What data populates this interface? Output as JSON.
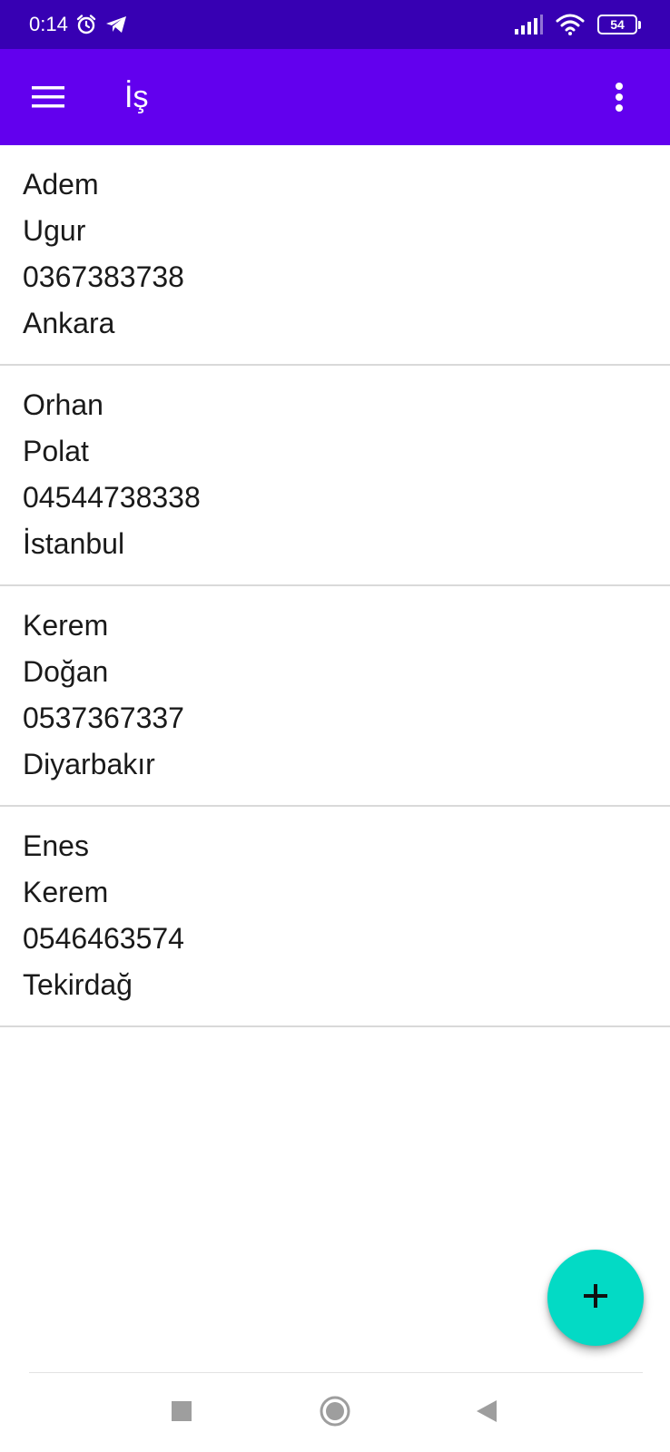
{
  "status_bar": {
    "time": "0:14",
    "battery_level": "54",
    "icons": [
      "alarm-icon",
      "telegram-icon",
      "signal-icon",
      "wifi-icon",
      "battery-icon"
    ]
  },
  "app_bar": {
    "title": "İş",
    "menu_icon": "hamburger-menu-icon",
    "overflow_icon": "more-vert-icon"
  },
  "contacts": [
    {
      "first_name": "Adem",
      "last_name": "Ugur",
      "phone": "0367383738",
      "city": "Ankara"
    },
    {
      "first_name": "Orhan",
      "last_name": "Polat",
      "phone": "04544738338",
      "city": "İstanbul"
    },
    {
      "first_name": "Kerem",
      "last_name": "Doğan",
      "phone": "0537367337",
      "city": "Diyarbakır"
    },
    {
      "first_name": "Enes",
      "last_name": "Kerem",
      "phone": "0546463574",
      "city": "Tekirdağ"
    }
  ],
  "fab": {
    "icon": "plus-icon"
  },
  "nav_bar": {
    "icons": [
      "recents-square-icon",
      "home-circle-icon",
      "back-triangle-icon"
    ]
  },
  "colors": {
    "status_bar": "#3700b3",
    "app_bar": "#6200ee",
    "fab": "#03dac5",
    "divider": "#d9d9d9"
  }
}
